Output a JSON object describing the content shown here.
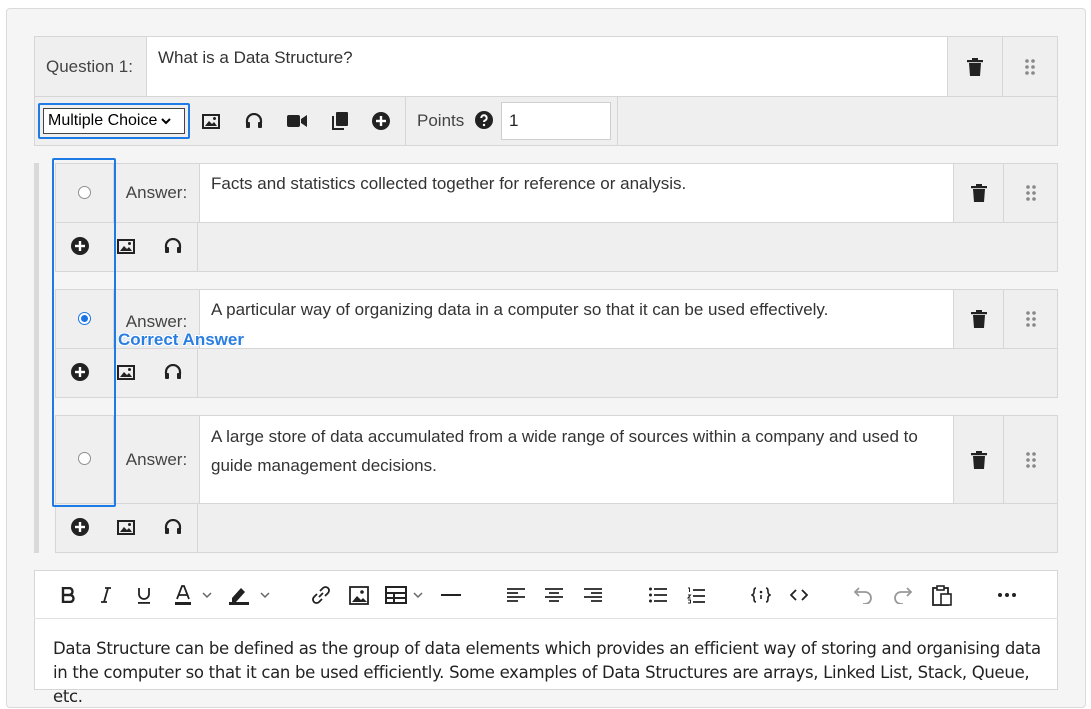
{
  "question": {
    "label": "Question 1:",
    "text": "What is a Data Structure?",
    "type_selected": "Multiple Choice",
    "points_label": "Points",
    "points_value": "1"
  },
  "answers": [
    {
      "label": "Answer:",
      "text": "Facts and statistics collected together for reference or analysis.",
      "checked": false
    },
    {
      "label": "Answer:",
      "text": "A particular way of organizing data in a computer so that it can be used effectively.",
      "checked": true
    },
    {
      "label": "Answer:",
      "text": "A large store of data accumulated from a wide range of sources within a company and used to guide management decisions.",
      "checked": false
    }
  ],
  "correct_annotation": "Correct Answer",
  "editor": {
    "content": "Data Structure can be defined as the group of data elements which provides an efficient way of storing and organising data in the computer so that it can be used efficiently. Some examples of Data Structures are arrays, Linked List, Stack, Queue, etc."
  },
  "colors": {
    "highlight": "#1e7be6",
    "radio_checked": "#1a73e8"
  }
}
